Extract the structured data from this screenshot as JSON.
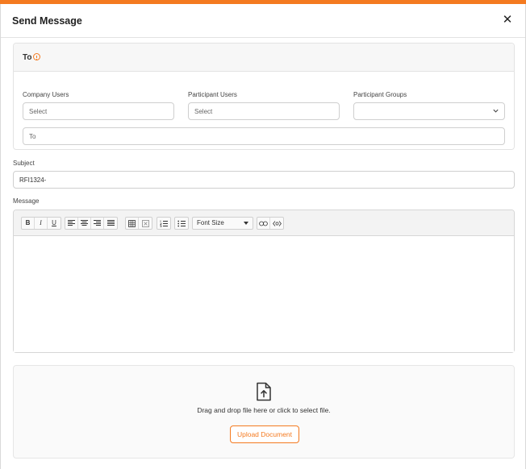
{
  "dialog": {
    "title": "Send Message",
    "close_icon": "close-icon"
  },
  "to_panel": {
    "label": "To",
    "info_icon": "info-icon",
    "company_users": {
      "label": "Company Users",
      "placeholder": "Select"
    },
    "participant_users": {
      "label": "Participant Users",
      "placeholder": "Select"
    },
    "participant_groups": {
      "label": "Participant Groups",
      "value": ""
    },
    "to_field": {
      "placeholder": "To"
    }
  },
  "subject": {
    "label": "Subject",
    "value": "RFI1324-"
  },
  "message": {
    "label": "Message",
    "toolbar": {
      "bold": "B",
      "italic": "I",
      "underline": "U",
      "font_size": "Font Size"
    },
    "body": ""
  },
  "upload": {
    "icon": "file-upload-icon",
    "text": "Drag and drop file here or click to select file.",
    "button": "Upload Document"
  },
  "colors": {
    "accent": "#f47a20"
  }
}
